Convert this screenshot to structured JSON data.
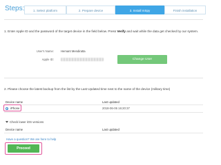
{
  "header": {
    "title": "Steps:",
    "steps": [
      {
        "label": "1. Select platform"
      },
      {
        "label": "2. Prepare device"
      },
      {
        "label": "3. Install mSpy"
      },
      {
        "label": "Finish installation"
      }
    ]
  },
  "section1": {
    "text_before": "1. Enter Apple ID and the password of the target device in the field below. Press ",
    "text_bold": "Verify",
    "text_after": " and wait while the data get checked by our system.",
    "username_label": "User's Name:",
    "username_value": "Hemant Mendiratta",
    "apple_id_label": "Apple ID:",
    "change_user_label": "Change User"
  },
  "section2": {
    "instructions": "2. Please choose the latest backup from the list by the Last Updated time next to the name of the device (military time)",
    "table": {
      "col_device": "Device name",
      "col_updated": "Last updated",
      "rows": [
        {
          "device": "iPhone",
          "updated": "2018-06-06 16:20:37"
        }
      ]
    },
    "lower_ios_label": "Check lower iOS versions",
    "table2": {
      "col_device": "Device name",
      "col_updated": "Last updated"
    }
  },
  "footer": {
    "help_link": "Have a question? We are here to help",
    "proceed_label": "Proceed"
  },
  "colors": {
    "active_step": "#3fa6e6",
    "change_user_button": "#74c87a",
    "proceed_button": "#52b655",
    "highlight": "#e0559a",
    "link": "#3a86c8"
  }
}
